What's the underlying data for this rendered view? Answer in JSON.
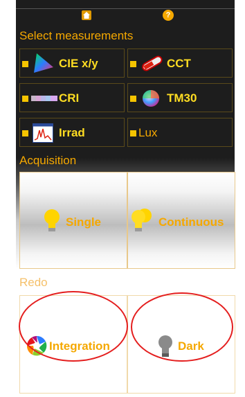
{
  "header": {
    "home_icon": "home-icon",
    "help_icon": "help-icon",
    "help_glyph": "?"
  },
  "measurements": {
    "title": "Select measurements",
    "items": [
      {
        "label": "CIE x/y",
        "icon": "cie-triangle-icon"
      },
      {
        "label": "CCT",
        "icon": "thermometer-icon"
      },
      {
        "label": "CRI",
        "icon": "color-swatches-icon"
      },
      {
        "label": "TM30",
        "icon": "color-wheel-icon"
      },
      {
        "label": "Irrad",
        "icon": "spectrum-chart-icon"
      },
      {
        "label": "Lux",
        "icon": ""
      }
    ]
  },
  "acquisition": {
    "title": "Acquisition",
    "single_label": "Single",
    "continuous_label": "Continuous"
  },
  "redo": {
    "title": "Redo",
    "integration_label": "Integration",
    "dark_label": "Dark"
  },
  "colors": {
    "accent": "#f5a800",
    "label_yellow": "#ffdd22",
    "background_dark": "#1d1d1d",
    "annotation_red": "#e41e1e"
  }
}
